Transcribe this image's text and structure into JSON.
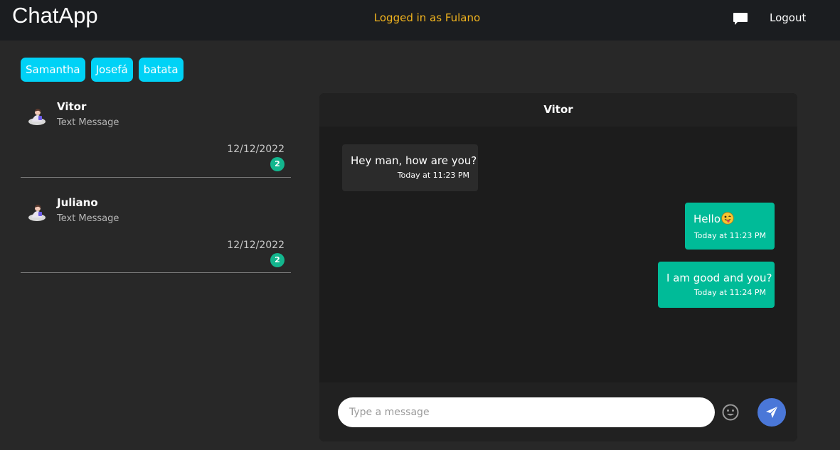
{
  "header": {
    "brand": "ChatApp",
    "logged_in_text": "Logged in as Fulano",
    "chat_icon": "chat-bubble-icon",
    "logout_label": "Logout"
  },
  "contacts": [
    "Samantha",
    "Josefá",
    "batata"
  ],
  "conversations": [
    {
      "name": "Vitor",
      "preview": "Text Message",
      "date": "12/12/2022",
      "unread": "2",
      "avatar_icon": "user-avatar-icon"
    },
    {
      "name": "Juliano",
      "preview": "Text Message",
      "date": "12/12/2022",
      "unread": "2",
      "avatar_icon": "user-avatar-icon"
    }
  ],
  "chat": {
    "title": "Vitor",
    "messages": [
      {
        "direction": "in",
        "text": "Hey man, how are you?",
        "time": "Today at 11:23 PM"
      },
      {
        "direction": "out",
        "text": "Hello",
        "emoji": "😛",
        "time": "Today at 11:23 PM"
      },
      {
        "direction": "out",
        "text": "I am good and you?",
        "time": "Today at 11:24 PM"
      }
    ],
    "input_placeholder": "Type a message",
    "input_value": "",
    "emoji_button_icon": "smiley-icon",
    "send_button_icon": "paper-plane-icon"
  },
  "colors": {
    "background": "#282828",
    "navbar": "#1b1d20",
    "brand_accent": "#f2b41e",
    "chip": "#00d2f6",
    "outgoing_bubble": "#00bb98",
    "incoming_bubble": "#2b2b2b",
    "badge": "#13b68e",
    "send_button": "#4a77d8"
  }
}
